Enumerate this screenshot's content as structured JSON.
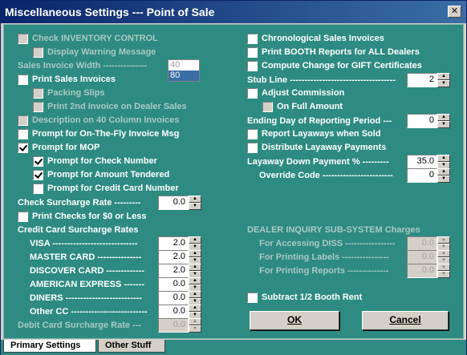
{
  "window": {
    "title": "Miscellaneous Settings --- Point of Sale",
    "close_glyph": "✕"
  },
  "left": {
    "check_inventory": {
      "label": "Check INVENTORY CONTROL",
      "checked": false,
      "enabled": false
    },
    "display_warning": {
      "label": "Display Warning Message",
      "checked": false,
      "enabled": false
    },
    "invoice_width": {
      "label": "Sales Invoice Width ---------------",
      "options": [
        "40",
        "80"
      ],
      "selected": "80"
    },
    "print_sales_invoices": {
      "label": "Print Sales Invoices",
      "checked": false
    },
    "packing_slips": {
      "label": "Packing Slips",
      "checked": false,
      "enabled": false
    },
    "print_2nd_invoice": {
      "label": "Print 2nd Invoice on Dealer Sales",
      "checked": false,
      "enabled": false
    },
    "description_40": {
      "label": "Description on 40 Column Invoices",
      "checked": false,
      "enabled": false
    },
    "prompt_otf": {
      "label": "Prompt for On-The-Fly Invoice Msg",
      "checked": false
    },
    "prompt_mop": {
      "label": "Prompt for MOP",
      "checked": true
    },
    "prompt_check_number": {
      "label": "Prompt for Check Number",
      "checked": true
    },
    "prompt_amount_tendered": {
      "label": "Prompt for Amount Tendered",
      "checked": true
    },
    "prompt_cc_number": {
      "label": "Prompt for Credit Card Number",
      "checked": false
    },
    "check_surcharge": {
      "label": "Check Surcharge Rate ---------",
      "value": "0.0"
    },
    "print_checks_zero": {
      "label": "Print Checks for $0 or Less",
      "checked": false
    },
    "cc_surcharge_header": "Credit Card Surcharge Rates",
    "cc_rates": [
      {
        "label": "VISA -----------------------------",
        "value": "2.0"
      },
      {
        "label": "MASTER CARD ---------------",
        "value": "2.0"
      },
      {
        "label": "DISCOVER CARD -------------",
        "value": "2.0"
      },
      {
        "label": "AMERICAN EXPRESS -------",
        "value": "0.0"
      },
      {
        "label": "DINERS --------------------------",
        "value": "0.0"
      },
      {
        "label": "Other CC --------------------------",
        "value": "0.0"
      }
    ],
    "debit_surcharge": {
      "label": "Debit Card Surcharge Rate ---",
      "value": "0.0",
      "enabled": false
    }
  },
  "right": {
    "chrono_invoices": {
      "label": "Chronological Sales Invoices",
      "checked": false
    },
    "print_booth": {
      "label": "Print BOOTH Reports for ALL Dealers",
      "checked": false
    },
    "compute_change": {
      "label": "Compute Change for GIFT Certificates",
      "checked": false
    },
    "stub_line": {
      "label": "Stub Line ------------------------------------",
      "value": "2"
    },
    "adjust_commission": {
      "label": "Adjust Commission",
      "checked": false
    },
    "on_full_amount": {
      "label": "On Full Amount",
      "checked": false,
      "enabled": false
    },
    "ending_day": {
      "label": "Ending Day of Reporting Period ---",
      "value": "0"
    },
    "report_layaways": {
      "label": "Report Layaways when Sold",
      "checked": false
    },
    "distribute_layaway": {
      "label": "Distribute Layaway Payments",
      "checked": false
    },
    "layaway_down": {
      "label": "Layaway Down Payment % ---------",
      "value": "35.0"
    },
    "override_code": {
      "label": "Override Code ------------------------",
      "value": "0"
    },
    "diss_header": "DEALER INQUIRY SUB-SYSTEM Charges",
    "diss_rows": [
      {
        "label": "For Accessing DISS -----------------",
        "value": "0.0"
      },
      {
        "label": "For Printing Labels ----------------",
        "value": "0.0"
      },
      {
        "label": "For Printing Reports --------------",
        "value": "0.0"
      }
    ],
    "subtract_booth": {
      "label": "Subtract 1/2 Booth Rent",
      "checked": false
    }
  },
  "buttons": {
    "ok": "OK",
    "cancel": "Cancel"
  },
  "tabs": [
    {
      "label": "Primary Settings",
      "active": true
    },
    {
      "label": "Other Stuff",
      "active": false
    }
  ],
  "colors": {
    "background": "#2e8b82",
    "title_start": "#0a246a",
    "title_end": "#3a6ea5",
    "disabled_text": "#aac8c4"
  },
  "icons": {
    "close": "close-icon",
    "spin_up": "arrow-up-icon",
    "spin_down": "arrow-down-icon",
    "check": "checkmark-icon"
  }
}
